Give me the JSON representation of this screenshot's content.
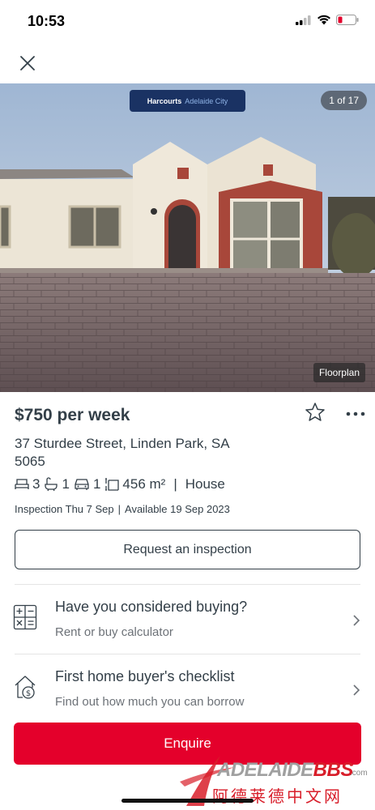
{
  "status": {
    "time": "10:53"
  },
  "gallery": {
    "counter": "1 of 17",
    "agency_brand": "Harcourts",
    "agency_sub": "Adelaide City",
    "floorplan_label": "Floorplan"
  },
  "listing": {
    "price": "$750 per week",
    "address": "37 Sturdee Street, Linden Park, SA 5065",
    "bedrooms": "3",
    "bathrooms": "1",
    "parking": "1",
    "land_size": "456 m²",
    "property_type": "House",
    "inspection": "Inspection Thu 7 Sep",
    "available": "Available 19 Sep 2023"
  },
  "actions": {
    "request_inspection": "Request an inspection",
    "enquire": "Enquire"
  },
  "promos": [
    {
      "title": "Have you considered buying?",
      "subtitle": "Rent or buy calculator"
    },
    {
      "title": "First home buyer's checklist",
      "subtitle": "Find out how much you can borrow"
    }
  ],
  "watermark": {
    "brand_prefix": "ADELAIDE",
    "brand_suffix": "BBS",
    "domain": ".com",
    "chinese": "阿德莱德中文网"
  },
  "colors": {
    "accent": "#e4002b",
    "text": "#333f48",
    "muted": "#6d7278"
  }
}
